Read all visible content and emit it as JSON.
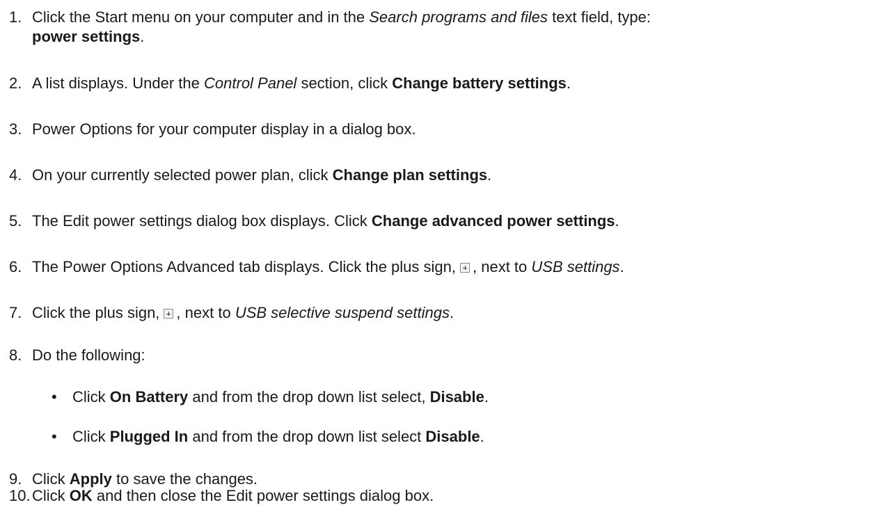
{
  "steps": [
    {
      "n": "1.",
      "a": "Click the Start menu on your computer and in the ",
      "b": "Search programs and files",
      "c": " text field, type:",
      "d": "power settings",
      "e": "."
    },
    {
      "n": "2.",
      "a": "A list displays. Under the ",
      "b": "Control Panel",
      "c": " section, click ",
      "d": "Change battery settings",
      "e": "."
    },
    {
      "n": "3.",
      "a": "Power Options for your computer display in a dialog box."
    },
    {
      "n": "4.",
      "a": "On your currently selected power plan, click ",
      "b": "Change plan settings",
      "c": "."
    },
    {
      "n": "5.",
      "a": "The Edit power settings dialog box displays. Click ",
      "b": "Change advanced power settings",
      "c": "."
    },
    {
      "n": "6.",
      "a": "The Power Options Advanced tab displays. Click the plus sign,",
      "b": ", next to ",
      "c": "USB settings",
      "d": "."
    },
    {
      "n": "7.",
      "a": "Click the plus sign,",
      "b": ", next to ",
      "c": "USB selective suspend settings",
      "d": "."
    },
    {
      "n": "8.",
      "a": "Do the following:"
    },
    {
      "n": "9.",
      "a": "Click ",
      "b": "Apply",
      "c": " to save the changes."
    },
    {
      "n": "10.",
      "a": "Click ",
      "b": "OK",
      "c": " and then close the Edit power settings dialog box."
    }
  ],
  "bullets": [
    {
      "mark": "•",
      "a": "Click ",
      "b": "On Battery",
      "c": " and from the drop down list select, ",
      "d": "Disable",
      "e": "."
    },
    {
      "mark": "•",
      "a": "Click ",
      "b": "Plugged In",
      "c": " and from the drop down list select ",
      "d": "Disable",
      "e": "."
    }
  ]
}
